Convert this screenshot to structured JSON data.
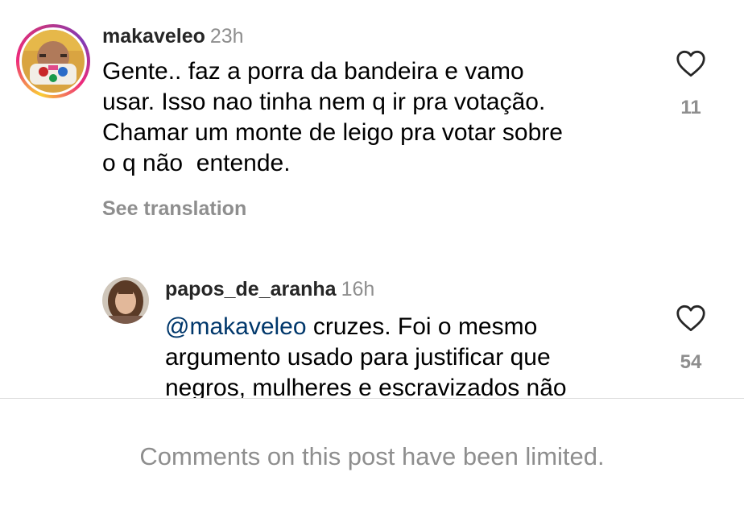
{
  "comments": [
    {
      "username": "makaveleo",
      "time": "23h",
      "lines": [
        "Gente.. faz a porra da bandeira e vamo",
        "usar. Isso nao tinha nem q ir pra votação.",
        "Chamar um monte de leigo pra votar sobre",
        "o q não  entende."
      ],
      "see_translation": "See translation",
      "like_count": "11",
      "like_icon": "heart-outline-icon",
      "avatar": "avatar-with-story-ring"
    }
  ],
  "reply": {
    "username": "papos_de_aranha",
    "time": "16h",
    "mention": "@makaveleo",
    "lines": [
      " cruzes. Foi o mesmo",
      "argumento usado para justificar que",
      "negros, mulheres e escravizados não"
    ],
    "like_count": "54",
    "like_icon": "heart-outline-icon"
  },
  "footer": {
    "limited_text": "Comments on this post have been limited."
  },
  "colors": {
    "text": "#000000",
    "username": "#262626",
    "secondary": "#8e8e8e",
    "mention": "#00376b",
    "divider": "#dbdbdb"
  }
}
